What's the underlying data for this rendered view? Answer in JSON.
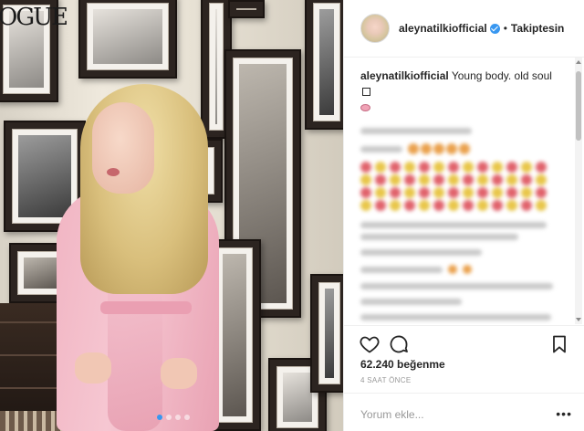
{
  "post": {
    "username": "aleynatilkiofficial",
    "follow_label": "Takiptesin",
    "separator": "•",
    "caption_user": "aleynatilkiofficial",
    "caption_text": "Young body. old soul",
    "likes": "62.240 beğenme",
    "timestamp": "4 SAAT ÖNCE",
    "comment_placeholder": "Yorum ekle...",
    "more_label": "•••",
    "photo_text": "OGUE"
  },
  "colors": {
    "verified": "#3897f0",
    "text": "#262626",
    "muted": "#999999",
    "border": "#efefef"
  },
  "icons": [
    "heart-icon",
    "comment-icon",
    "bookmark-icon",
    "verified-badge-icon",
    "more-icon"
  ]
}
